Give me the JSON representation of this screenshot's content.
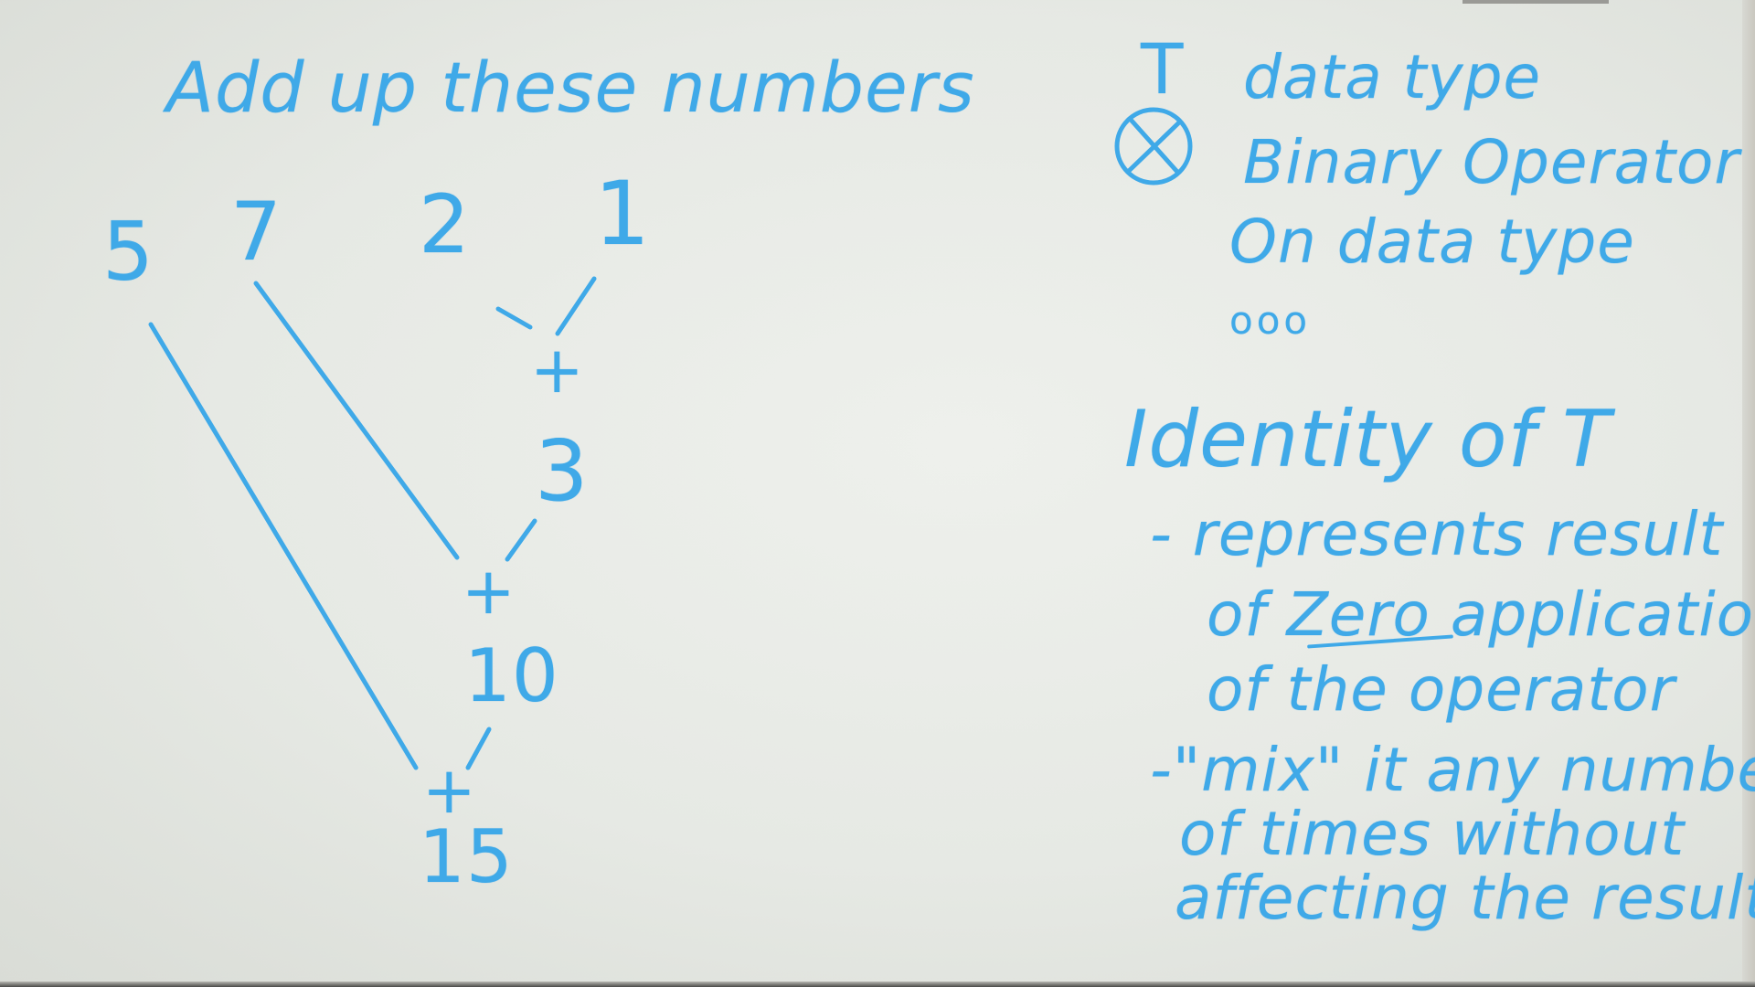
{
  "left": {
    "title": "Add up these numbers",
    "numbers": [
      "5",
      "7",
      "2",
      "1"
    ],
    "plus": "+",
    "results": [
      "3",
      "10",
      "15"
    ]
  },
  "right": {
    "type_symbol": "T",
    "type_label": "data type",
    "operator_icon": "circled-x-icon",
    "operator_line1": "Binary Operator",
    "operator_line2": "On data type",
    "ellipsis": "ooo",
    "identity_heading": "Identity of T",
    "bullet1_line1": "- represents result",
    "bullet1_line2": "of Zero applications",
    "bullet1_line3": "of the operator",
    "bullet2_line1": "-\"mix\" it any number",
    "bullet2_line2": "of times without",
    "bullet2_line3": "affecting the result"
  },
  "ink_color": "#3fa9e8",
  "board_color": "#e6e9e4"
}
